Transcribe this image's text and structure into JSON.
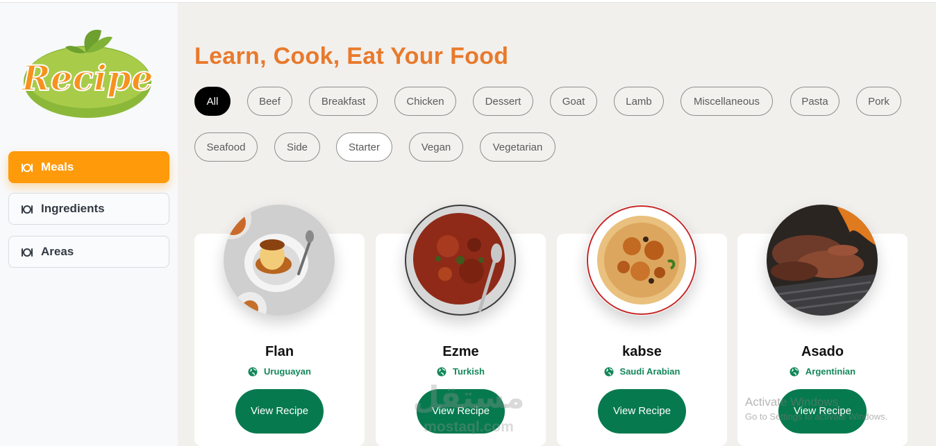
{
  "headline": "Learn, Cook, Eat Your Food",
  "logo": {
    "text": "Recipe"
  },
  "nav": [
    {
      "label": "Meals",
      "icon": "plate-icon",
      "active": true
    },
    {
      "label": "Ingredients",
      "icon": "plate-icon",
      "active": false
    },
    {
      "label": "Areas",
      "icon": "plate-icon",
      "active": false
    }
  ],
  "categories": [
    "All",
    "Beef",
    "Breakfast",
    "Chicken",
    "Dessert",
    "Goat",
    "Lamb",
    "Miscellaneous",
    "Pasta",
    "Pork",
    "Seafood",
    "Side",
    "Starter",
    "Vegan",
    "Vegetarian"
  ],
  "selected_category": "All",
  "meals": [
    {
      "name": "Flan",
      "area": "Uruguayan",
      "button": "View Recipe",
      "image_icon": "flan-dish-icon"
    },
    {
      "name": "Ezme",
      "area": "Turkish",
      "button": "View Recipe",
      "image_icon": "ezme-dish-icon"
    },
    {
      "name": "kabse",
      "area": "Saudi Arabian",
      "button": "View Recipe",
      "image_icon": "kabse-dish-icon"
    },
    {
      "name": "Asado",
      "area": "Argentinian",
      "button": "View Recipe",
      "image_icon": "asado-dish-icon"
    }
  ],
  "overlays": {
    "watermark_ar": "مستقل",
    "watermark_en": "mostaql.com",
    "activate_title": "Activate Windows",
    "activate_sub": "Go to Settings to activate Windows."
  },
  "colors": {
    "accent": "#ff9a0a",
    "headline": "#e87a2c",
    "button": "#067a4e",
    "area_text": "#13875a"
  }
}
